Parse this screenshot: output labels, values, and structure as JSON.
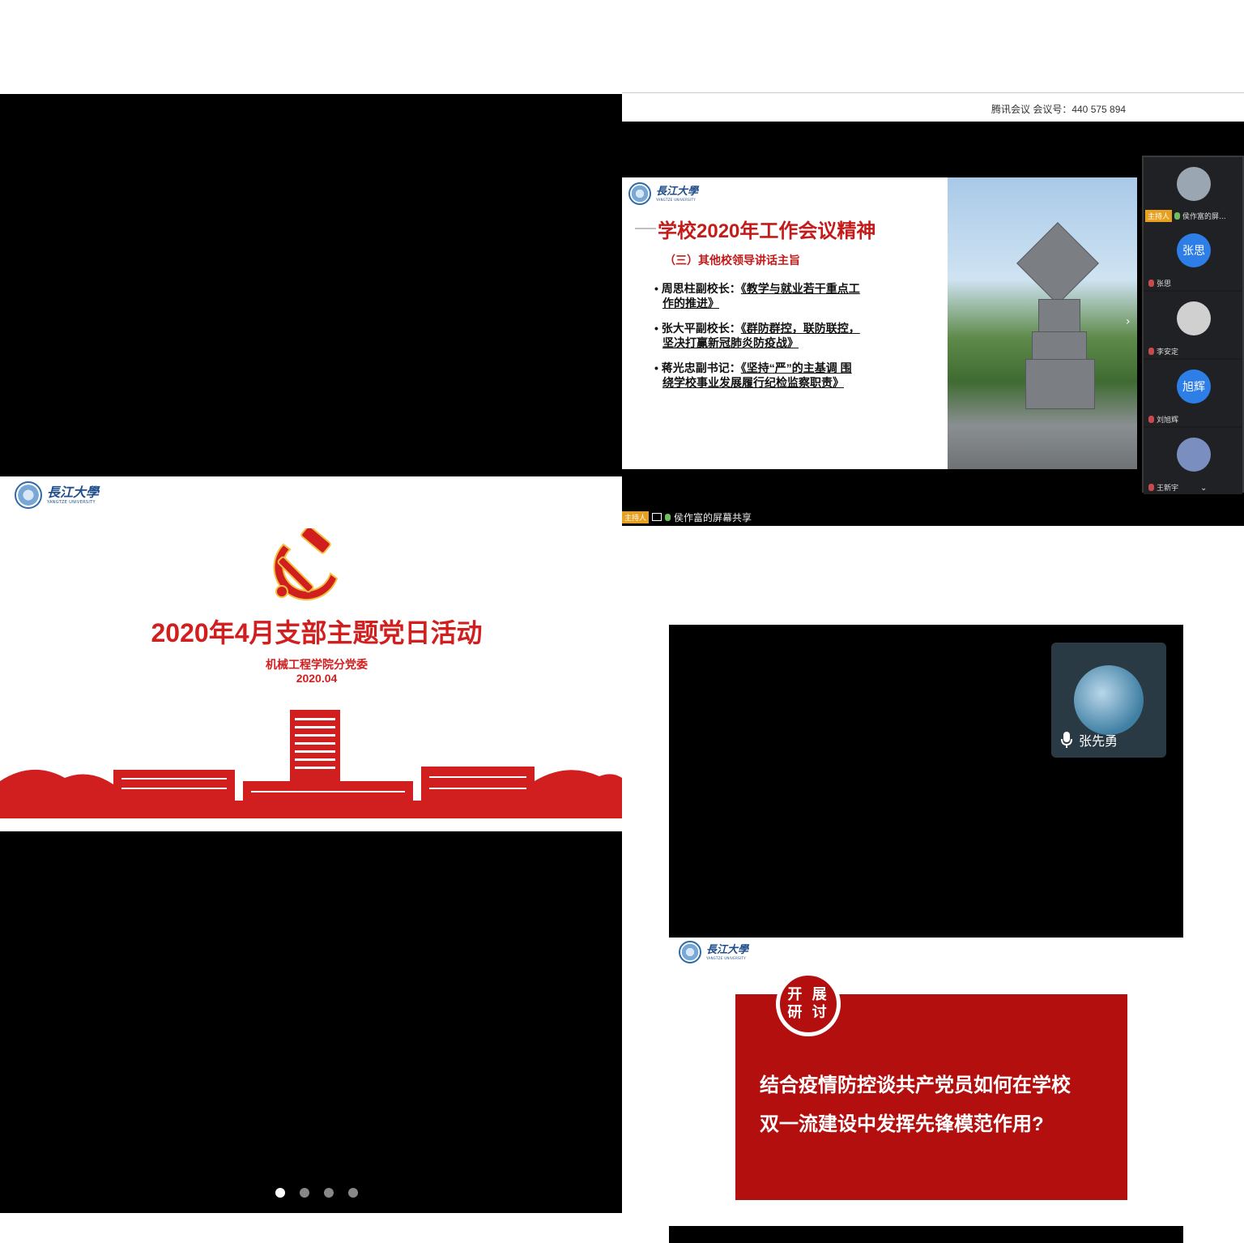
{
  "left_screenshot": {
    "logo_cn": "長江大學",
    "logo_en": "YANGTZE UNIVERSITY",
    "title": "2020年4月支部主题党日活动",
    "subtitle": "机械工程学院分党委",
    "date": "2020.04",
    "carousel": {
      "count": 4,
      "active_index": 0
    }
  },
  "meeting": {
    "topbar_text": "腾讯会议 会议号：440 575 894",
    "slide": {
      "logo_cn": "長江大學",
      "logo_en": "YANGTZE UNIVERSITY",
      "title": "学校2020年工作会议精神",
      "section": "（三）其他校领导讲话主旨",
      "bullets": [
        {
          "speaker": "周思柱副校长：",
          "line1": "《教学与就业若干重点工",
          "line2": "作的推进》"
        },
        {
          "speaker": "张大平副校长：",
          "line1": "《群防群控，联防联控，",
          "line2": "坚决打赢新冠肺炎防疫战》"
        },
        {
          "speaker": "蒋光忠副书记：",
          "line1": "《坚持“严”的主基调  围",
          "line2": "绕学校事业发展履行纪检监察职责》"
        }
      ]
    },
    "participants": [
      {
        "name": "侯作富的屏...",
        "host_label": "主持人",
        "avatar_text": "",
        "avatar_color": "#9aa7b3"
      },
      {
        "name": "张思",
        "avatar_text": "张思",
        "avatar_color": "#2d7ee6"
      },
      {
        "name": "李安定",
        "avatar_text": "",
        "avatar_color": "#d0d0d0"
      },
      {
        "name": "刘旭辉",
        "avatar_text": "旭辉",
        "avatar_color": "#2d7ee6"
      },
      {
        "name": "王新宇",
        "avatar_text": "",
        "avatar_color": "#7a8fbf"
      }
    ],
    "status_host_label": "主持人",
    "status_text": "侯作富的屏幕共享"
  },
  "right_screenshot": {
    "video_name": "张先勇",
    "slide": {
      "logo_cn": "長江大學",
      "logo_en": "YANGTZE UNIVERSITY",
      "badge_line1": "开 展",
      "badge_line2": "研 讨",
      "question_line1": "结合疫情防控谈共产党员如何在学校",
      "question_line2": "双一流建设中发挥先锋模范作用?"
    }
  },
  "colors": {
    "party_red": "#d11e1e",
    "slide_red": "#b30f0f",
    "meeting_blue": "#2d7ee6",
    "host_orange": "#e8a020"
  }
}
